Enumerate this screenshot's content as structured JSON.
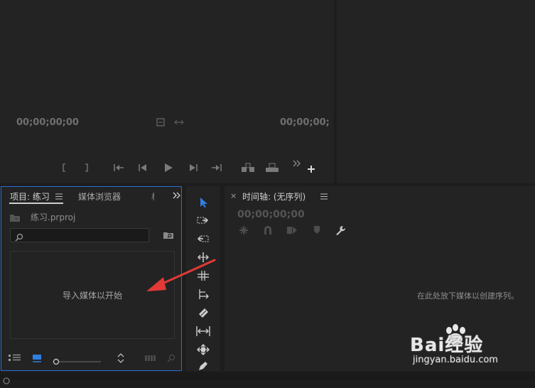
{
  "source_monitor": {
    "timecode_left": "00;00;00;00"
  },
  "program_monitor": {
    "timecode_right": "00;00;00;"
  },
  "project_panel": {
    "tab_project": "项目: 练习",
    "tab_media_browser": "媒体浏览器",
    "tab_more": "»",
    "project_file": "练习.prproj",
    "search_placeholder": "",
    "empty_message": "导入媒体以开始"
  },
  "timeline_panel": {
    "close_glyph": "×",
    "tab_title": "时间轴: (无序列)",
    "timecode": "00;00;00;00",
    "drop_hint": "在此处放下媒体以创建序列。"
  },
  "watermark": {
    "logo_text": "Bai经验",
    "url": "jingyan.baidu.com"
  },
  "colors": {
    "panel_bg": "#232323",
    "app_bg": "#1d1d1d",
    "focus_border": "#2e6bd6",
    "selection_tool": "#2f7fe0",
    "arrow_annotation": "#e23a36"
  }
}
